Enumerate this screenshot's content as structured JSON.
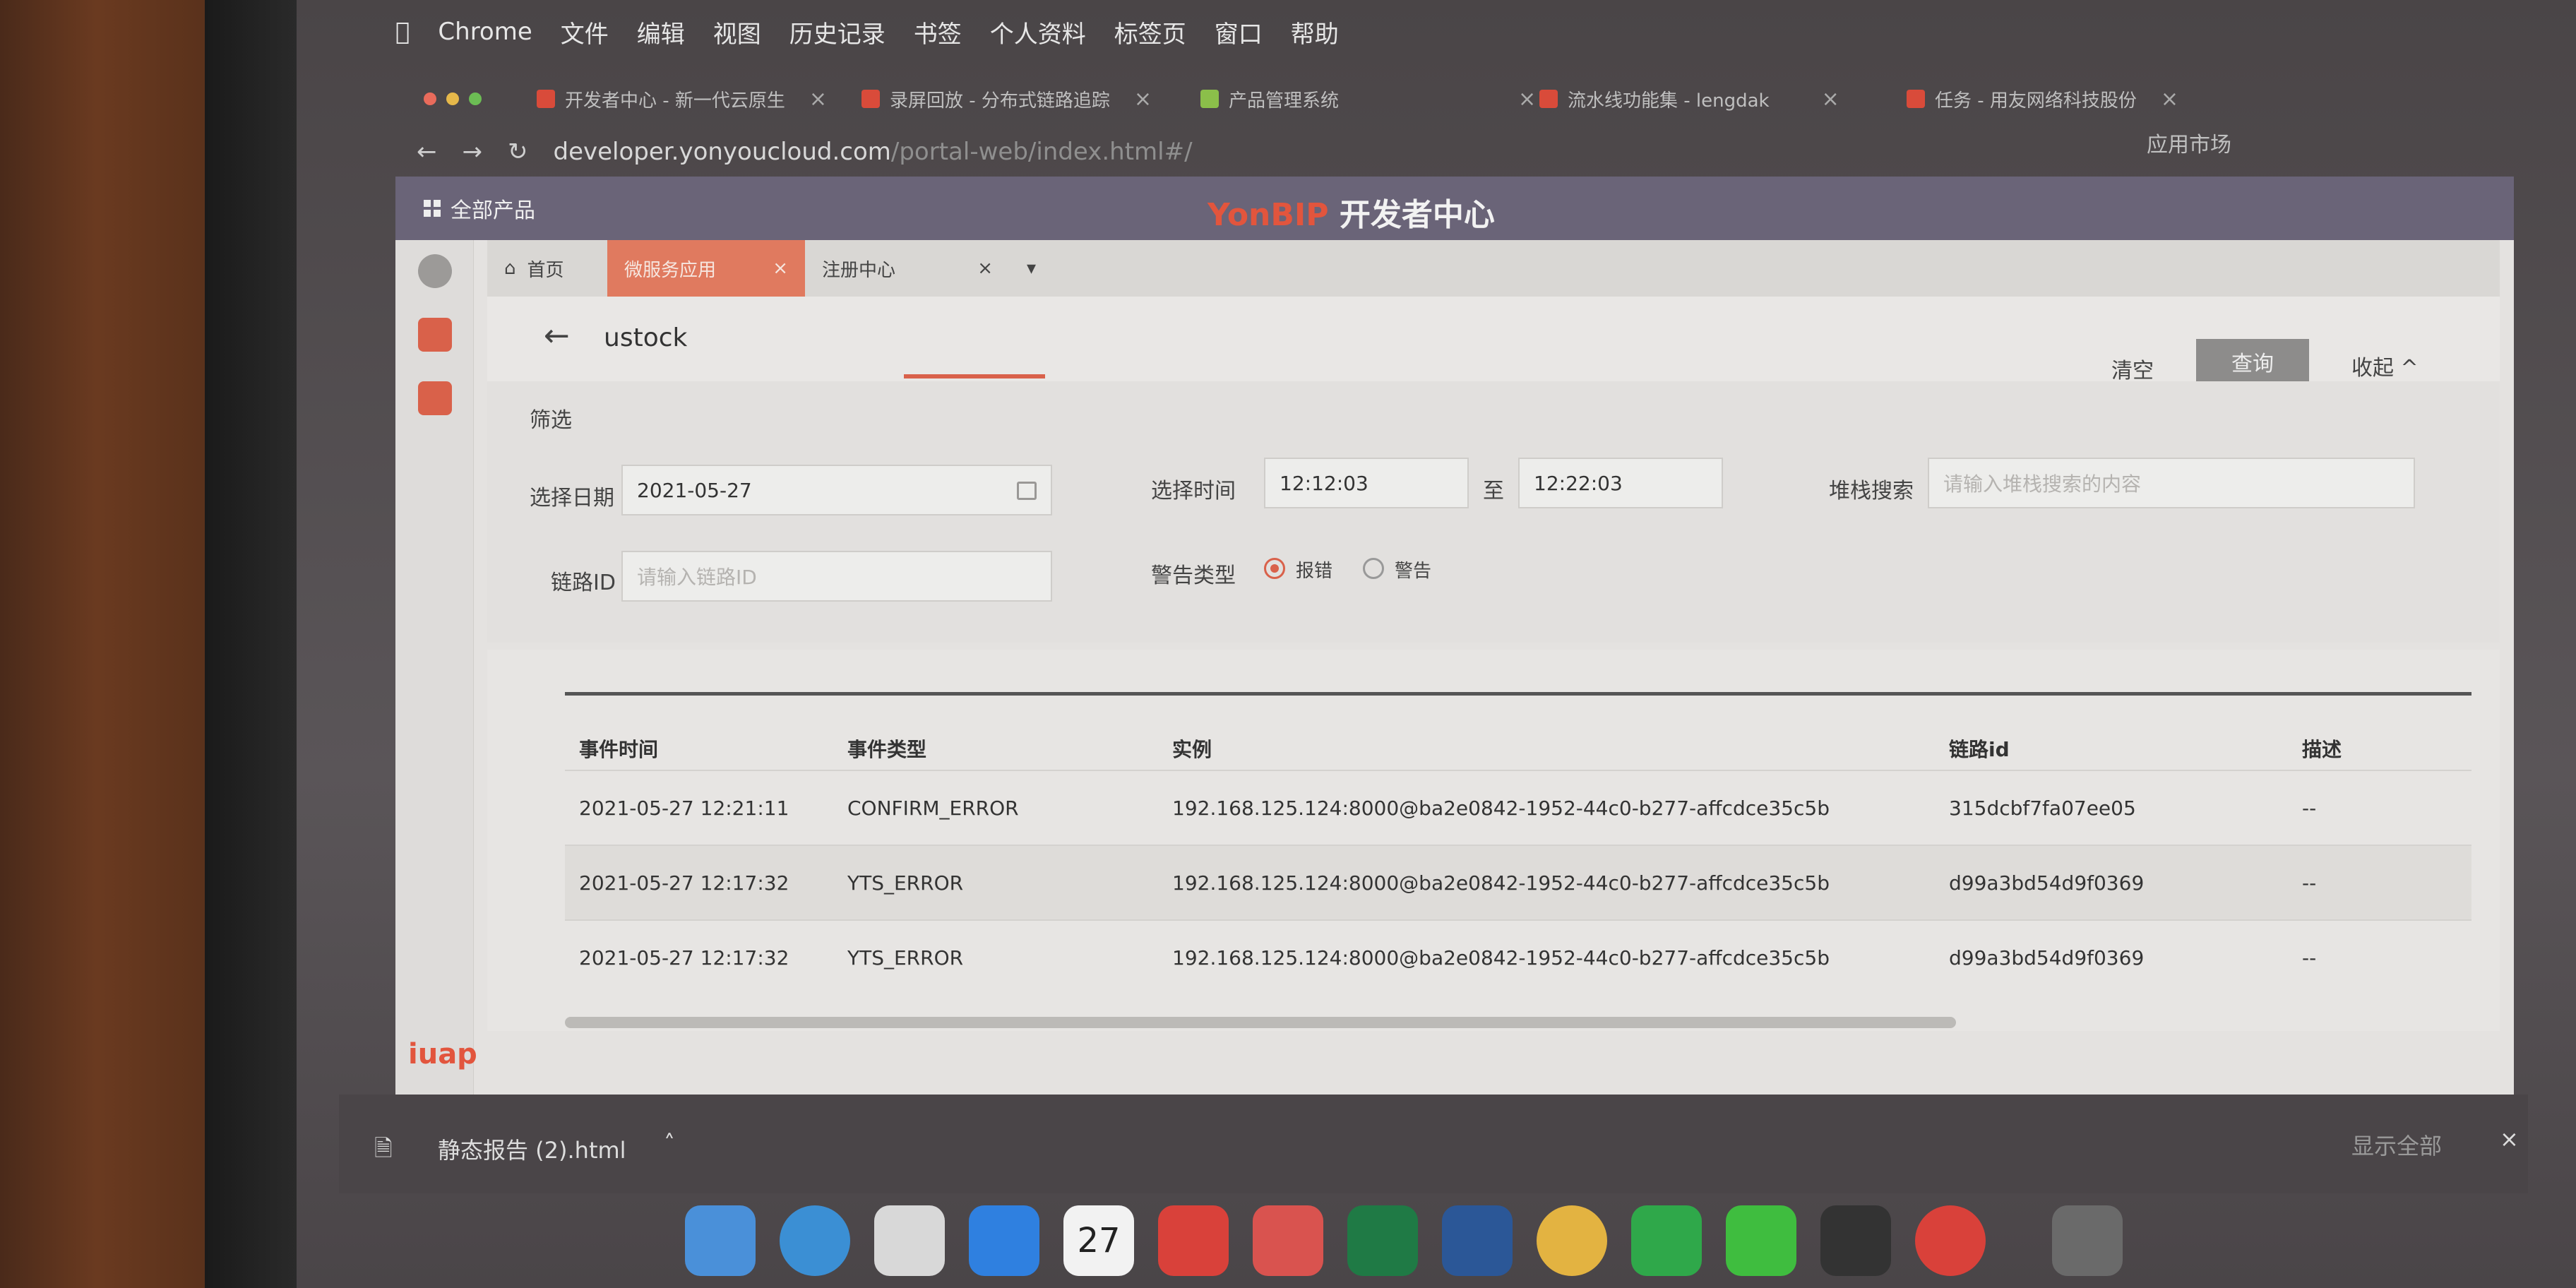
{
  "mac_menu": [
    "Chrome",
    "文件",
    "编辑",
    "视图",
    "历史记录",
    "书签",
    "个人资料",
    "标签页",
    "窗口",
    "帮助"
  ],
  "browser_tabs": [
    {
      "label": "开发者中心 - 新一代云原生"
    },
    {
      "label": "录屏回放 - 分布式链路追踪"
    },
    {
      "label": "产品管理系统"
    },
    {
      "label": "流水线功能集 - lengdak"
    },
    {
      "label": "任务 - 用友网络科技股份"
    }
  ],
  "address_bar": {
    "domain": "developer.yonyoucloud.com",
    "path": "/portal-web/index.html#/"
  },
  "topbar": {
    "all_products": "全部产品",
    "brand_yon": "YonBIP",
    "brand_rest": " 开发者中心",
    "market": "应用市场"
  },
  "app_tabs": [
    {
      "label": "首页"
    },
    {
      "label": "微服务应用"
    },
    {
      "label": "注册中心"
    }
  ],
  "page": {
    "back": "←",
    "title": "ustock",
    "clear": "清空",
    "query": "查询",
    "collapse": "收起 ^"
  },
  "filters": {
    "section_title": "筛选",
    "date_label": "选择日期",
    "date_value": "2021-05-27",
    "time_label": "选择时间",
    "time_start": "12:12:03",
    "time_to": "至",
    "time_end": "12:22:03",
    "stack_label": "堆栈搜索",
    "stack_placeholder": "请输入堆栈搜索的内容",
    "trace_label": "链路ID",
    "trace_placeholder": "请输入链路ID",
    "alert_label": "警告类型",
    "alert_error": "报错",
    "alert_warn": "警告",
    "alert_selected": "报错"
  },
  "table": {
    "columns": [
      "事件时间",
      "事件类型",
      "实例",
      "链路id",
      "描述"
    ],
    "rows": [
      [
        "2021-05-27 12:21:11",
        "CONFIRM_ERROR",
        "192.168.125.124:8000@ba2e0842-1952-44c0-b277-affcdce35c5b",
        "315dcbf7fa07ee05",
        "--"
      ],
      [
        "2021-05-27 12:17:32",
        "YTS_ERROR",
        "192.168.125.124:8000@ba2e0842-1952-44c0-b277-affcdce35c5b",
        "d99a3bd54d9f0369",
        "--"
      ],
      [
        "2021-05-27 12:17:32",
        "YTS_ERROR",
        "192.168.125.124:8000@ba2e0842-1952-44c0-b277-affcdce35c5b",
        "d99a3bd54d9f0369",
        "--"
      ]
    ]
  },
  "sidebar_logo": "iuap",
  "download_bar": {
    "file": "静态报告 (2).html",
    "show_all": "显示全部",
    "close": "×"
  },
  "dock": {
    "calendar_day": "27"
  }
}
